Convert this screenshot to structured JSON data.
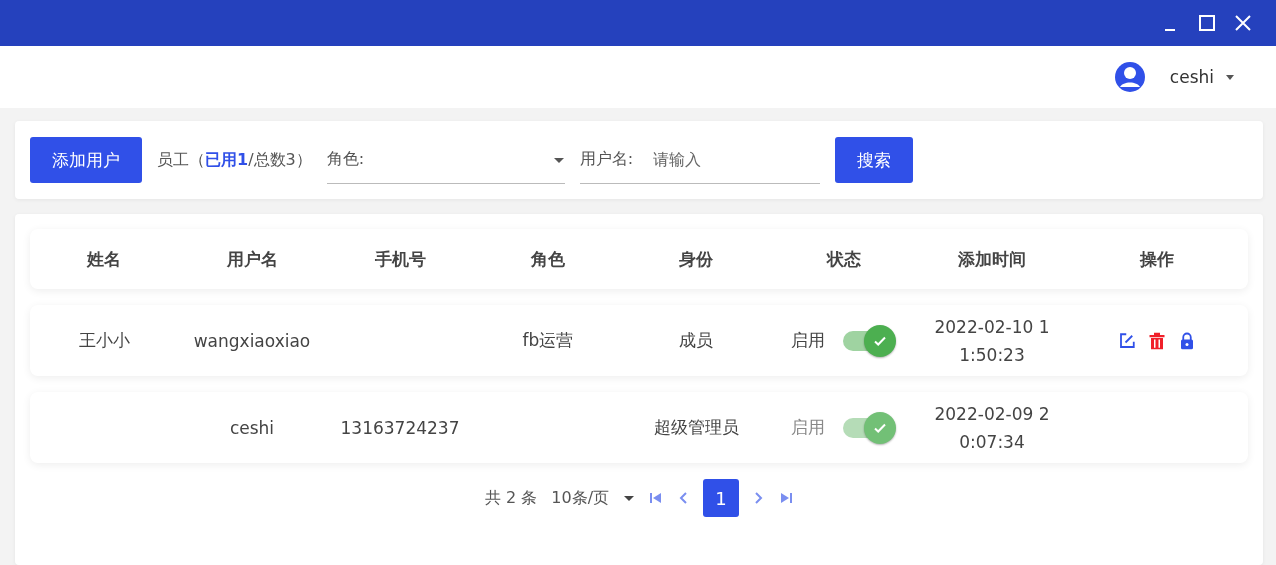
{
  "header": {
    "username": "ceshi"
  },
  "toolbar": {
    "add_button": "添加用户",
    "staff_count": "员工（**已用1**/总数3）",
    "role_label": "角色:",
    "username_label": "用户名:",
    "username_placeholder": "请输入",
    "search_button": "搜索"
  },
  "table": {
    "columns": [
      "姓名",
      "用户名",
      "手机号",
      "角色",
      "身份",
      "状态",
      "添加时间",
      "操作"
    ],
    "rows": [
      {
        "name": "王小小",
        "username": "wangxiaoxiao",
        "phone": "",
        "role": "fb运营",
        "identity": "成员",
        "status": "启用",
        "on": true,
        "disabled": false,
        "added": "2022-02-10 11:50:23",
        "actions": true
      },
      {
        "name": "",
        "username": "ceshi",
        "phone": "13163724237",
        "role": "",
        "identity": "超级管理员",
        "status": "启用",
        "on": true,
        "disabled": true,
        "added": "2022-02-09 20:07:34",
        "actions": false
      }
    ]
  },
  "pagination": {
    "total": "共 2 条",
    "page_size": "10条/页",
    "pages": [
      {
        "label": "1",
        "selected": true
      }
    ]
  }
}
